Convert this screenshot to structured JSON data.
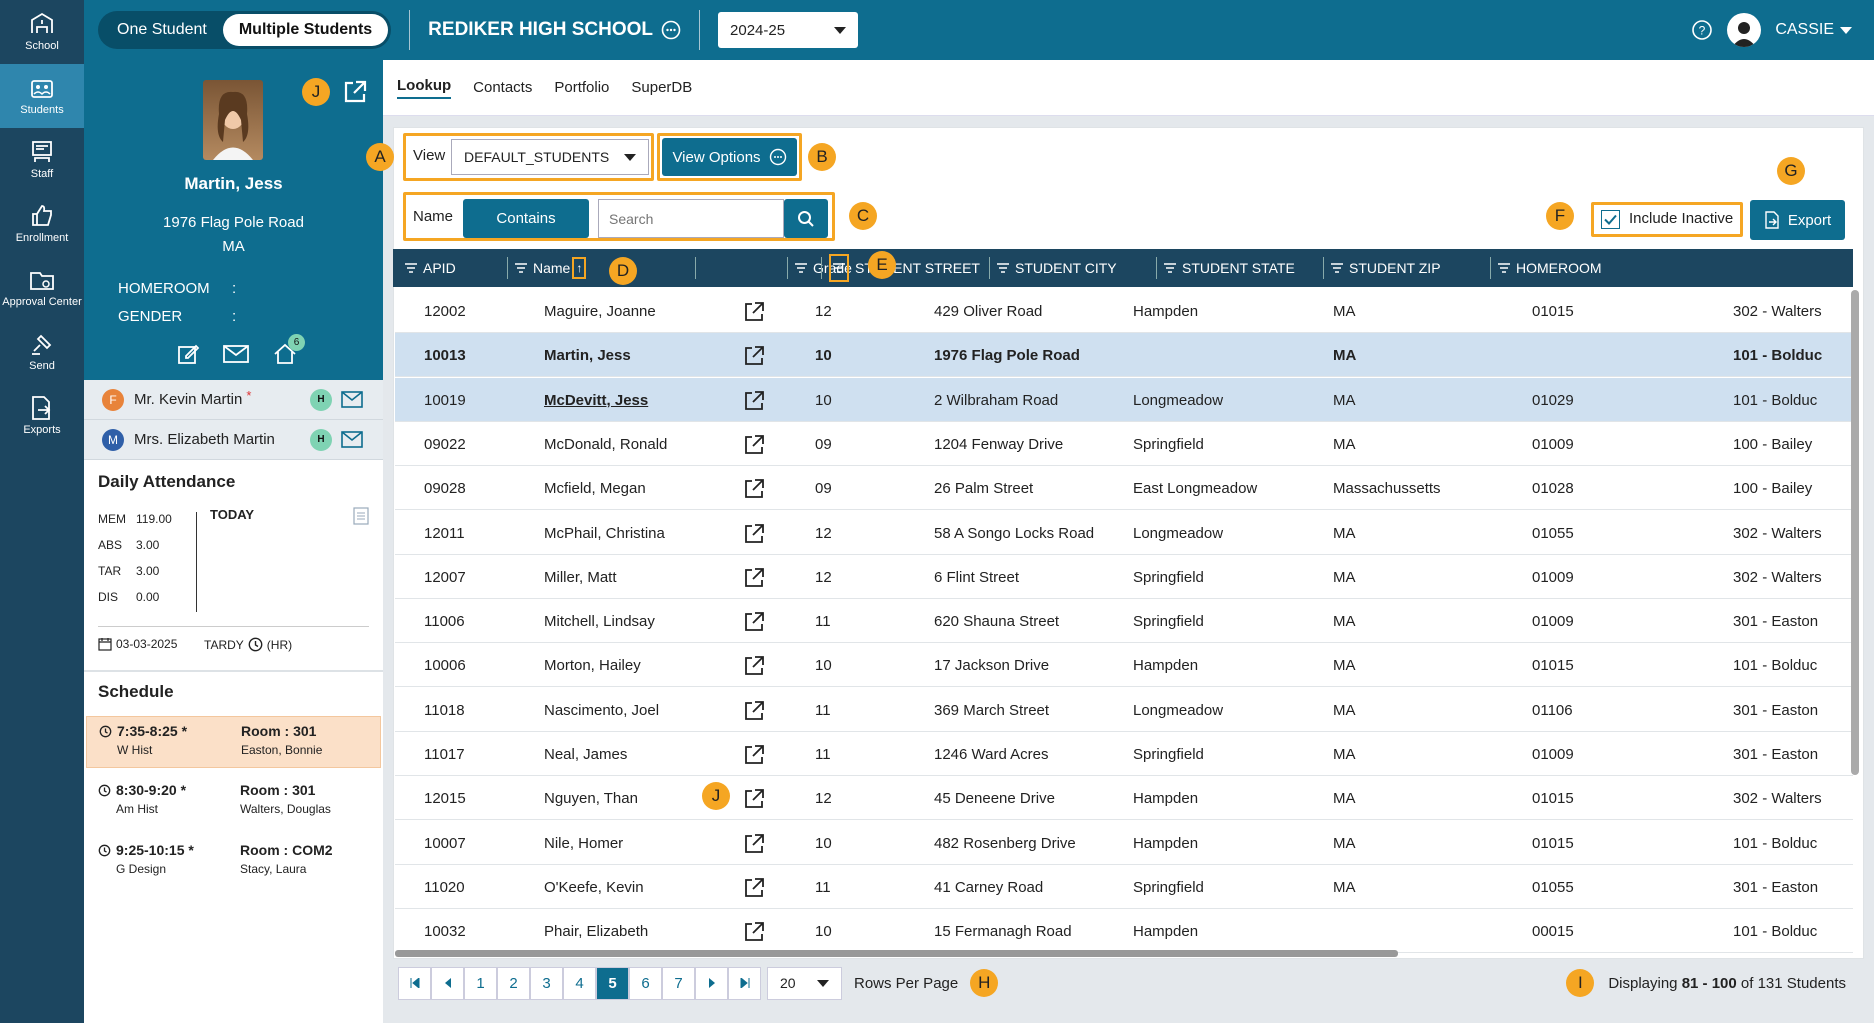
{
  "nav": {
    "items": [
      {
        "label": "School",
        "icon": "school-icon"
      },
      {
        "label": "Students",
        "icon": "students-icon"
      },
      {
        "label": "Staff",
        "icon": "staff-icon"
      },
      {
        "label": "Enrollment",
        "icon": "thumbs-up-icon"
      },
      {
        "label": "Approval Center",
        "icon": "folder-icon"
      },
      {
        "label": "Send",
        "icon": "satellite-icon"
      },
      {
        "label": "Exports",
        "icon": "export-file-icon"
      }
    ]
  },
  "topbar": {
    "toggle_one": "One Student",
    "toggle_multi": "Multiple Students",
    "school": "REDIKER HIGH SCHOOL",
    "year": "2024-25",
    "user": "CASSIE"
  },
  "badges": {
    "a": "A",
    "b": "B",
    "c": "C",
    "d": "D",
    "e": "E",
    "f": "F",
    "g": "G",
    "h": "H",
    "i": "I",
    "j": "J"
  },
  "profile": {
    "name": "Martin, Jess",
    "street": "1976 Flag Pole Road",
    "state": "MA",
    "homeroom_label": "HOMEROOM",
    "gender_label": "GENDER",
    "colon": ":",
    "notif_count": "6"
  },
  "contacts": [
    {
      "initial": "F",
      "name": "Mr. Kevin Martin",
      "star": "*",
      "h": "H",
      "color": "#e8833a"
    },
    {
      "initial": "M",
      "name": "Mrs. Elizabeth Martin",
      "star": "",
      "h": "H",
      "color": "#2f5fa8"
    }
  ],
  "attendance": {
    "title": "Daily Attendance",
    "rows": [
      {
        "label": "MEM",
        "value": "119.00"
      },
      {
        "label": "ABS",
        "value": "3.00"
      },
      {
        "label": "TAR",
        "value": "3.00"
      },
      {
        "label": "DIS",
        "value": "0.00"
      }
    ],
    "today": "TODAY",
    "date": "03-03-2025",
    "tardy": "TARDY",
    "hr": "(HR)"
  },
  "schedule": {
    "title": "Schedule",
    "items": [
      {
        "time": "7:35-8:25 *",
        "course": "W Hist",
        "room": "Room : 301",
        "teacher": "Easton, Bonnie"
      },
      {
        "time": "8:30-9:20 *",
        "course": "Am Hist",
        "room": "Room : 301",
        "teacher": "Walters, Douglas"
      },
      {
        "time": "9:25-10:15 *",
        "course": "G Design",
        "room": "Room : COM2",
        "teacher": "Stacy, Laura"
      }
    ]
  },
  "tabs": [
    "Lookup",
    "Contacts",
    "Portfolio",
    "SuperDB"
  ],
  "toolbar": {
    "view_label": "View",
    "view_value": "DEFAULT_STUDENTS",
    "view_options": "View Options",
    "name_label": "Name",
    "contains": "Contains",
    "search_placeholder": "Search",
    "include_inactive": "Include Inactive",
    "export": "Export"
  },
  "columns": [
    "APID",
    "Name",
    "Grade",
    "STUDENT STREET",
    "STUDENT CITY",
    "STUDENT STATE",
    "STUDENT ZIP",
    "HOMEROOM"
  ],
  "sort_arrow": "↑",
  "rows": [
    {
      "apid": "12002",
      "name": "Maguire, Joanne",
      "grade": "12",
      "street": "429 Oliver Road",
      "city": "Hampden",
      "state": "MA",
      "zip": "01015",
      "homeroom": "302 - Walters"
    },
    {
      "apid": "10013",
      "name": "Martin, Jess",
      "grade": "10",
      "street": "1976 Flag Pole Road",
      "city": "",
      "state": "MA",
      "zip": "",
      "homeroom": "101 - Bolduc"
    },
    {
      "apid": "10019",
      "name": "McDevitt, Jess",
      "grade": "10",
      "street": "2 Wilbraham Road",
      "city": "Longmeadow",
      "state": "MA",
      "zip": "01029",
      "homeroom": "101 - Bolduc"
    },
    {
      "apid": "09022",
      "name": "McDonald, Ronald",
      "grade": "09",
      "street": "1204 Fenway Drive",
      "city": "Springfield",
      "state": "MA",
      "zip": "01009",
      "homeroom": "100 - Bailey"
    },
    {
      "apid": "09028",
      "name": "Mcfield, Megan",
      "grade": "09",
      "street": "26 Palm Street",
      "city": "East Longmeadow",
      "state": "Massachussetts",
      "zip": "01028",
      "homeroom": "100 - Bailey"
    },
    {
      "apid": "12011",
      "name": "McPhail, Christina",
      "grade": "12",
      "street": "58 A Songo Locks Road",
      "city": "Longmeadow",
      "state": "MA",
      "zip": "01055",
      "homeroom": "302 - Walters"
    },
    {
      "apid": "12007",
      "name": "Miller, Matt",
      "grade": "12",
      "street": "6 Flint Street",
      "city": "Springfield",
      "state": "MA",
      "zip": "01009",
      "homeroom": "302 - Walters"
    },
    {
      "apid": "11006",
      "name": "Mitchell, Lindsay",
      "grade": "11",
      "street": "620 Shauna Street",
      "city": "Springfield",
      "state": "MA",
      "zip": "01009",
      "homeroom": "301 - Easton"
    },
    {
      "apid": "10006",
      "name": "Morton, Hailey",
      "grade": "10",
      "street": "17 Jackson Drive",
      "city": "Hampden",
      "state": "MA",
      "zip": "01015",
      "homeroom": "101 - Bolduc"
    },
    {
      "apid": "11018",
      "name": "Nascimento, Joel",
      "grade": "11",
      "street": "369 March Street",
      "city": "Longmeadow",
      "state": "MA",
      "zip": "01106",
      "homeroom": "301 - Easton"
    },
    {
      "apid": "11017",
      "name": "Neal, James",
      "grade": "11",
      "street": "1246 Ward Acres",
      "city": "Springfield",
      "state": "MA",
      "zip": "01009",
      "homeroom": "301 - Easton"
    },
    {
      "apid": "12015",
      "name": "Nguyen, Than",
      "grade": "12",
      "street": "45 Deneene Drive",
      "city": "Hampden",
      "state": "MA",
      "zip": "01015",
      "homeroom": "302 - Walters"
    },
    {
      "apid": "10007",
      "name": "Nile, Homer",
      "grade": "10",
      "street": "482 Rosenberg Drive",
      "city": "Hampden",
      "state": "MA",
      "zip": "01015",
      "homeroom": "101 - Bolduc"
    },
    {
      "apid": "11020",
      "name": "O'Keefe, Kevin",
      "grade": "11",
      "street": "41 Carney Road",
      "city": "Springfield",
      "state": "MA",
      "zip": "01055",
      "homeroom": "301 - Easton"
    },
    {
      "apid": "10032",
      "name": "Phair, Elizabeth",
      "grade": "10",
      "street": "15 Fermanagh Road",
      "city": "Hampden",
      "state": "",
      "zip": "00015",
      "homeroom": "101 - Bolduc"
    }
  ],
  "pager": {
    "pages": [
      "1",
      "2",
      "3",
      "4",
      "5",
      "6",
      "7"
    ],
    "current": "5",
    "rows_per_page": "20",
    "rows_per_page_label": "Rows Per Page",
    "displaying": "Displaying",
    "range": "81 - 100",
    "of": "of 131 Students"
  },
  "colors": {
    "brand": "#0e6d8f",
    "nav": "#1c4660",
    "accent": "#f5a623",
    "selected_row": "#cfe0f0"
  }
}
